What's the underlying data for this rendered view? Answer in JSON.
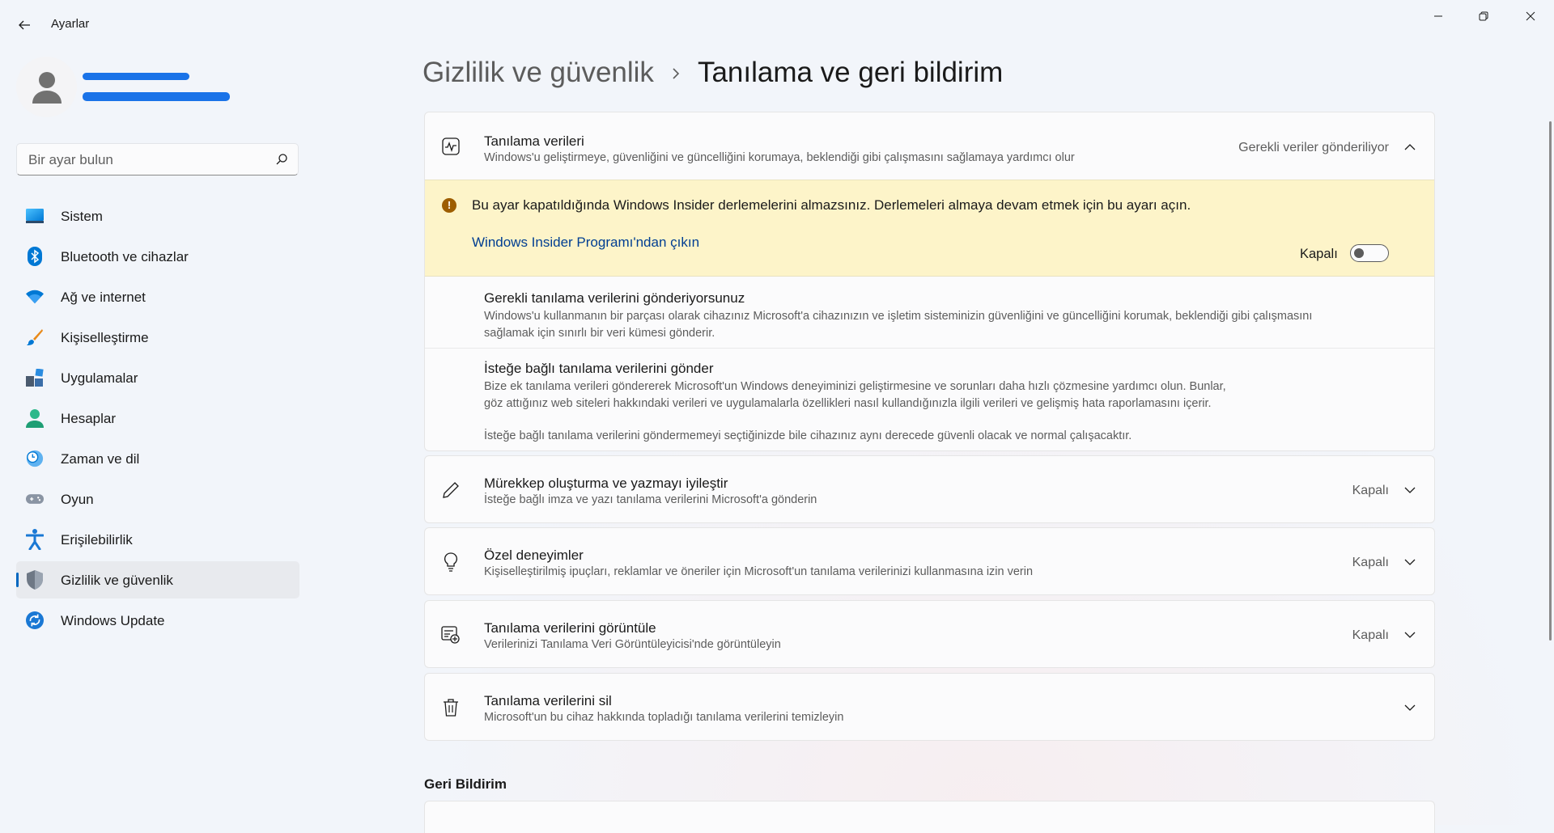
{
  "window": {
    "title": "Ayarlar"
  },
  "search": {
    "placeholder": "Bir ayar bulun"
  },
  "sidebar": {
    "items": [
      {
        "label": "Sistem",
        "icon": "monitor-icon"
      },
      {
        "label": "Bluetooth ve cihazlar",
        "icon": "bluetooth-icon"
      },
      {
        "label": "Ağ ve internet",
        "icon": "wifi-icon"
      },
      {
        "label": "Kişiselleştirme",
        "icon": "brush-icon"
      },
      {
        "label": "Uygulamalar",
        "icon": "apps-icon"
      },
      {
        "label": "Hesaplar",
        "icon": "person-icon"
      },
      {
        "label": "Zaman ve dil",
        "icon": "clock-globe-icon"
      },
      {
        "label": "Oyun",
        "icon": "gamepad-icon"
      },
      {
        "label": "Erişilebilirlik",
        "icon": "accessibility-icon"
      },
      {
        "label": "Gizlilik ve güvenlik",
        "icon": "shield-icon",
        "active": true
      },
      {
        "label": "Windows Update",
        "icon": "update-icon"
      }
    ]
  },
  "breadcrumb": {
    "parent": "Gizlilik ve güvenlik",
    "current": "Tanılama ve geri bildirim"
  },
  "diagnostic_card": {
    "title": "Tanılama verileri",
    "desc": "Windows'u geliştirmeye, güvenliğini ve güncelliğini korumaya, beklendiği gibi çalışmasını sağlamaya yardımcı olur",
    "status": "Gerekli veriler gönderiliyor",
    "warning": {
      "text": "Bu ayar kapatıldığında Windows Insider derlemelerini almazsınız. Derlemeleri almaya devam etmek için bu ayarı açın.",
      "link": "Windows Insider Programı'ndan çıkın"
    },
    "required": {
      "title": "Gerekli tanılama verilerini gönderiyorsunuz",
      "desc_line1": "Windows'u kullanmanın bir parçası olarak cihazınız Microsoft'a cihazınızın ve işletim sisteminizin güvenliğini ve güncelliğini korumak, beklendiği gibi çalışmasını",
      "desc_line2": "sağlamak için sınırlı bir veri kümesi gönderir."
    },
    "optional": {
      "title": "İsteğe bağlı tanılama verilerini gönder",
      "desc_line1": "Bize ek tanılama verileri göndererek Microsoft'un Windows deneyiminizi geliştirmesine ve sorunları daha hızlı çözmesine yardımcı olun. Bunlar,",
      "desc_line2": "göz attığınız web siteleri hakkındaki verileri ve uygulamalarla özellikleri nasıl kullandığınızla ilgili verileri ve gelişmiş hata raporlamasını içerir.",
      "note": "İsteğe bağlı tanılama verilerini göndermemeyi seçtiğinizde bile cihazınız aynı derecede güvenli olacak ve normal çalışacaktır.",
      "toggle_label": "Kapalı",
      "toggle_on": false
    }
  },
  "cards": [
    {
      "title": "Mürekkep oluşturma ve yazmayı iyileştir",
      "desc": "İsteğe bağlı imza ve yazı tanılama verilerini Microsoft'a gönderin",
      "status": "Kapalı",
      "icon": "pen-icon"
    },
    {
      "title": "Özel deneyimler",
      "desc": "Kişiselleştirilmiş ipuçları, reklamlar ve öneriler için Microsoft'un tanılama verilerinizi kullanmasına izin verin",
      "status": "Kapalı",
      "icon": "lightbulb-icon"
    },
    {
      "title": "Tanılama verilerini görüntüle",
      "desc": "Verilerinizi Tanılama Veri Görüntüleyicisi'nde görüntüleyin",
      "status": "Kapalı",
      "icon": "data-viewer-icon"
    },
    {
      "title": "Tanılama verilerini sil",
      "desc": "Microsoft'un bu cihaz hakkında topladığı tanılama verilerini temizleyin",
      "status": "",
      "icon": "trash-icon"
    }
  ],
  "feedback": {
    "heading": "Geri Bildirim"
  },
  "colors": {
    "accent": "#0067c0",
    "warning_bg": "#fdf4c9",
    "link": "#003e92"
  }
}
